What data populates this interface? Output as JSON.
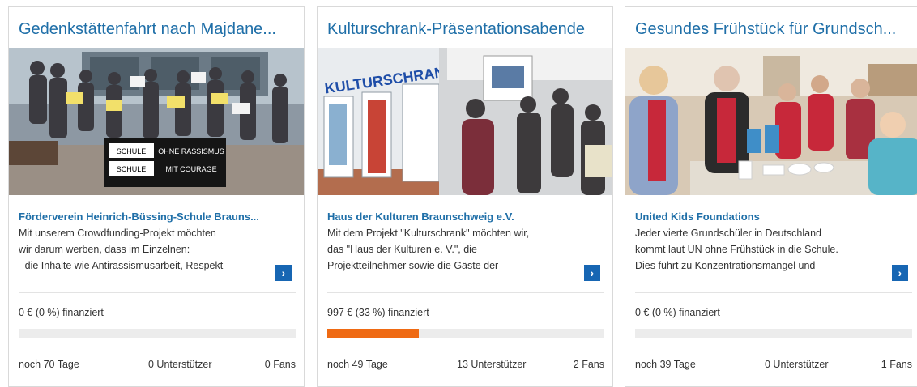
{
  "cards": [
    {
      "title": "Gedenkstättenfahrt nach Majdane...",
      "org": "Förderverein Heinrich-Büssing-Schule Brauns...",
      "description": "Mit unserem Crowdfunding-Projekt möchten\nwir darum werben, dass im Einzelnen:\n- die Inhalte wie Antirassismusarbeit, Respekt",
      "funded": "0 € (0 %) finanziert",
      "progress_percent": 0,
      "days": "noch 70 Tage",
      "supporters": "0 Unterstützer",
      "fans": "0 Fans",
      "banner_line1_left": "SCHULE",
      "banner_line1_right": "OHNE RASSISMUS",
      "banner_line2_left": "SCHULE",
      "banner_line2_right": "MIT COURAGE"
    },
    {
      "title": "Kulturschrank-Präsentationsabende",
      "org": "Haus der Kulturen Braunschweig e.V.",
      "description": "Mit dem Projekt \"Kulturschrank\" möchten wir,\ndas \"Haus der Kulturen e. V.\", die\nProjektteilnehmer sowie die Gäste der",
      "funded": "997 € (33 %) finanziert",
      "progress_percent": 33,
      "days": "noch 49 Tage",
      "supporters": "13 Unterstützer",
      "fans": "2 Fans",
      "wall_text": "KULTURSCHRANK"
    },
    {
      "title": "Gesundes Frühstück für Grundsch...",
      "org": "United Kids Foundations",
      "description": "Jeder vierte Grundschüler in Deutschland\nkommt laut UN ohne Frühstück in die Schule.\nDies führt zu Konzentrationsmangel und",
      "funded": "0 € (0 %) finanziert",
      "progress_percent": 0,
      "days": "noch 39 Tage",
      "supporters": "0 Unterstützer",
      "fans": "1 Fans"
    }
  ],
  "more_icon": "chevron-right-icon",
  "colors": {
    "accent": "#1f6fa8",
    "button": "#1766b3",
    "progress": "#ef6a13",
    "track": "#ececec"
  }
}
